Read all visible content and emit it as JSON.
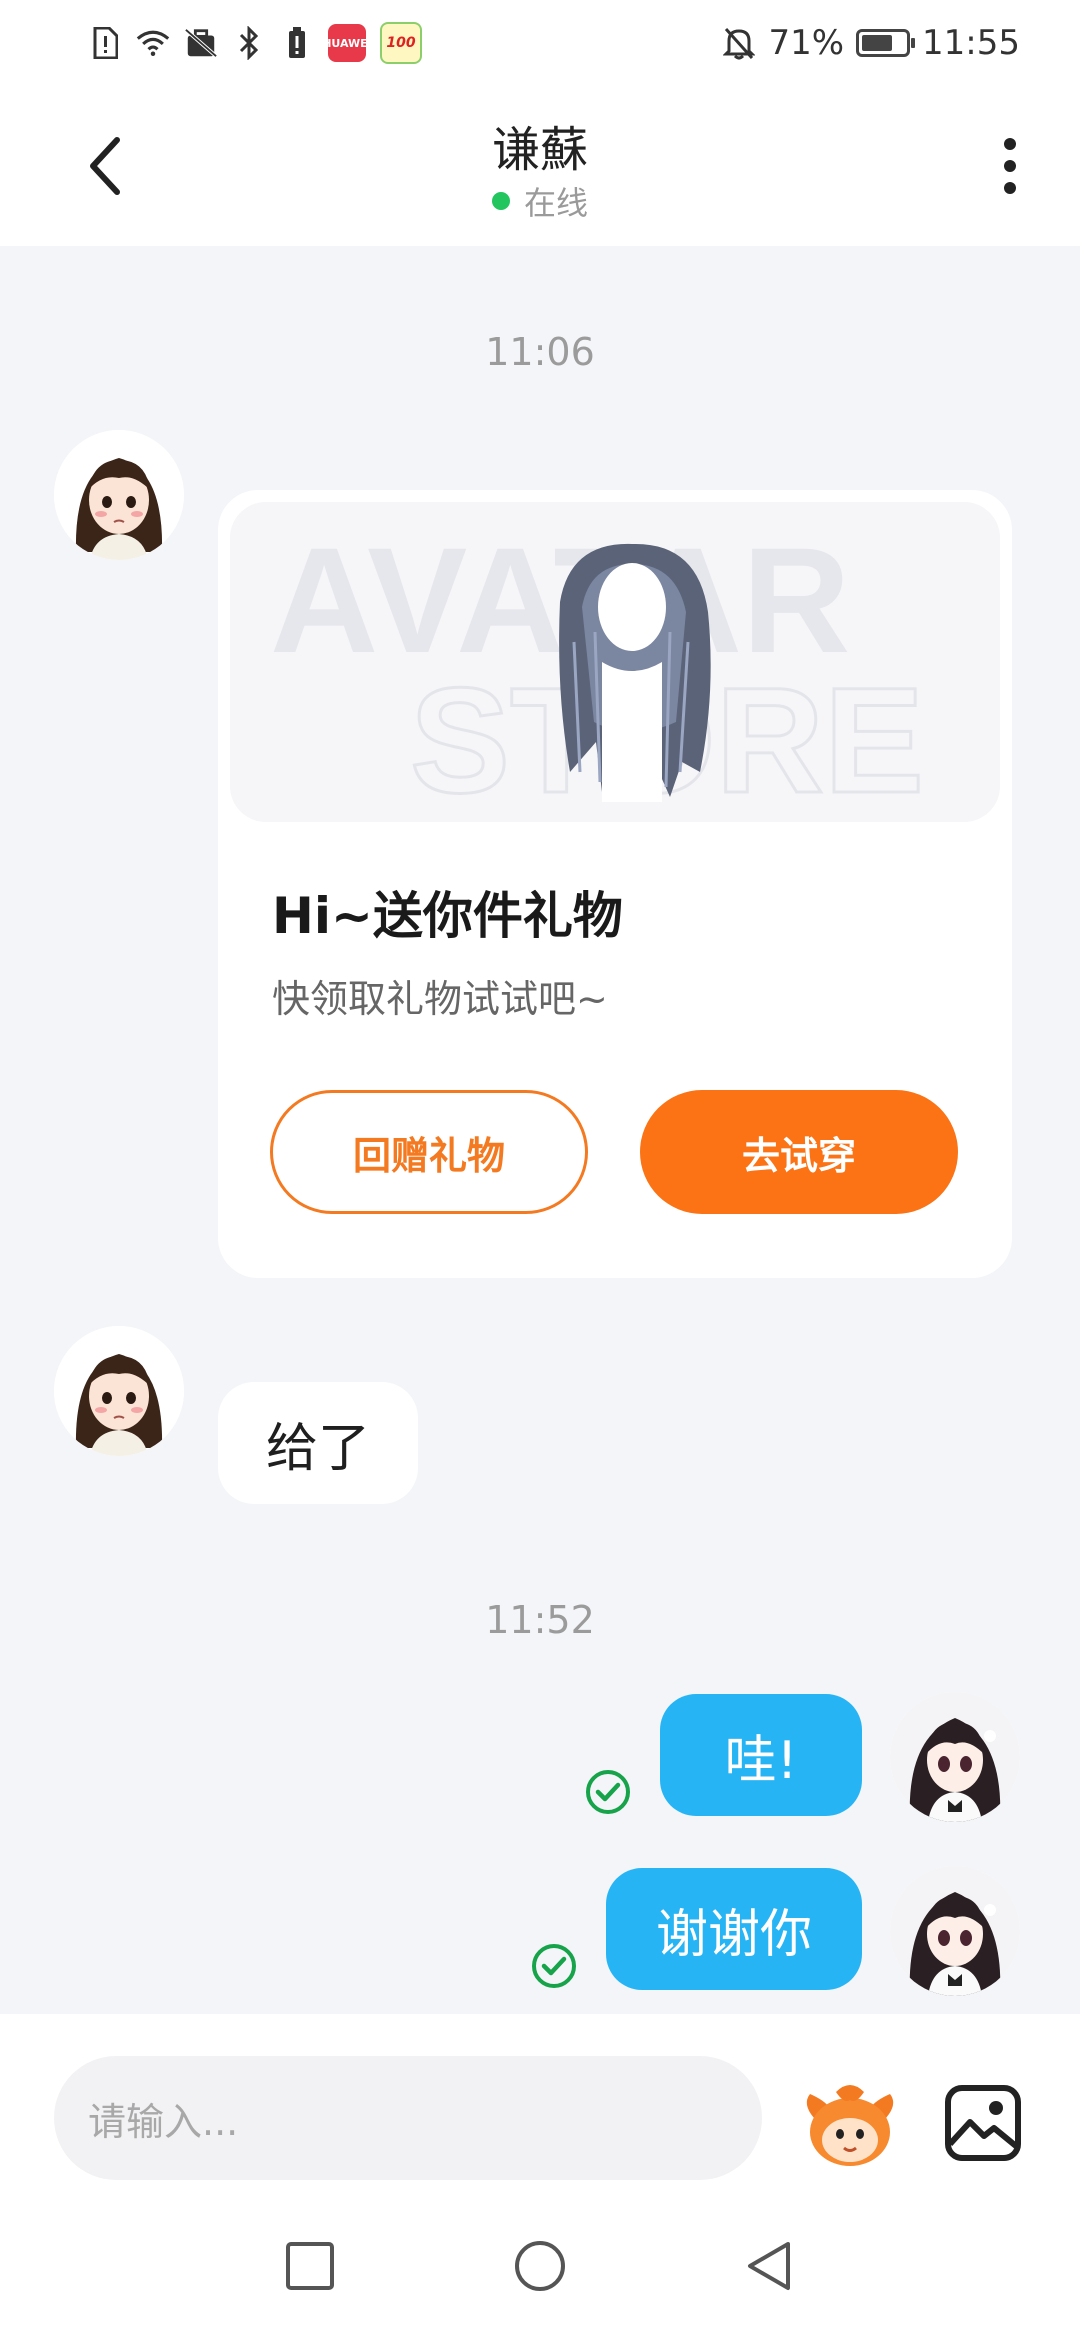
{
  "status_bar": {
    "battery_percent": "71%",
    "battery_level": 0.71,
    "time": "11:55",
    "app_badges": [
      "HUAWEI",
      "100"
    ]
  },
  "header": {
    "title": "谦蘇",
    "presence": "在线",
    "presence_color": "#22c55e"
  },
  "messages": {
    "timestamp_1": "11:06",
    "gift_card": {
      "watermark_line1": "AVATAR",
      "watermark_line2": "STORE",
      "title": "Hi~送你件礼物",
      "subtitle": "快领取礼物试试吧~",
      "return_gift_label": "回赠礼物",
      "try_on_label": "去试穿"
    },
    "incoming_text": "给了",
    "timestamp_2": "11:52",
    "outgoing_1": "哇!",
    "outgoing_2": "谢谢你"
  },
  "input": {
    "placeholder": "请输入..."
  },
  "colors": {
    "accent_orange": "#fb7314",
    "bubble_blue": "#27b4f5",
    "read_check_green": "#16a34a",
    "background": "#f3f5f8"
  },
  "icons": {
    "back": "chevron-left-icon",
    "more": "more-vertical-icon",
    "emoji": "mascot-sticker-icon",
    "image": "image-icon",
    "nav_recent": "square-icon",
    "nav_home": "circle-icon",
    "nav_back": "triangle-back-icon"
  }
}
